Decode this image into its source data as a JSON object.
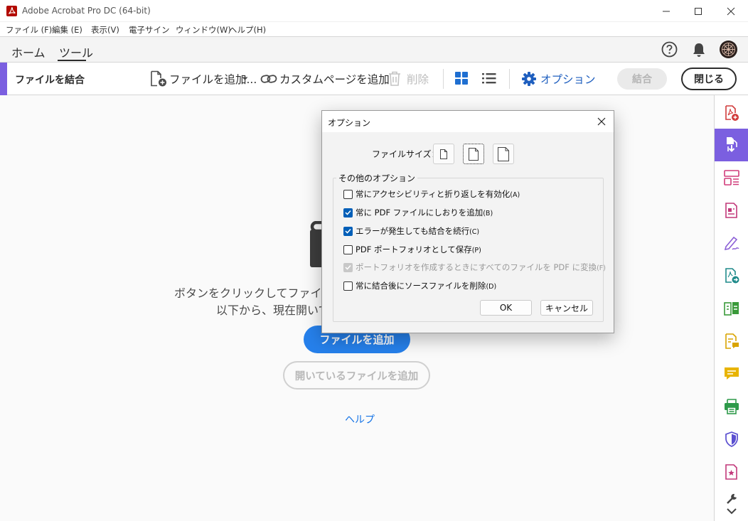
{
  "window": {
    "title": "Adobe Acrobat Pro DC (64-bit)",
    "controls": [
      "minimize-icon",
      "maximize-icon",
      "close-icon"
    ]
  },
  "menu": [
    {
      "label": "ファイル (F)"
    },
    {
      "label": "編集 (E)"
    },
    {
      "label": "表示(V)"
    },
    {
      "label": "電子サイン"
    },
    {
      "label": "ウィンドウ(W)"
    },
    {
      "label": "ヘルプ(H)"
    }
  ],
  "tabs": {
    "home": "ホーム",
    "tools": "ツール",
    "active": "ツール"
  },
  "header_icons": [
    "help-icon",
    "bell-icon",
    "avatar"
  ],
  "toolbar": {
    "tool_name": "ファイルを結合",
    "add_files": "ファイルを追加...",
    "custom_page": "カスタムページを追加",
    "delete": "削除",
    "options": "オプション",
    "combine": "結合",
    "close": "閉じる"
  },
  "main": {
    "line1": "ボタンをクリックしてファイルを追加",
    "line2": "以下から、現在開いて",
    "add_files_button": "ファイルを追加",
    "add_open_files_button": "開いているファイルを追加",
    "help": "ヘルプ"
  },
  "right_rail": [
    "create-pdf-icon",
    "combine-files-icon",
    "organize-pages-icon",
    "edit-pdf-icon",
    "fill-sign-icon",
    "export-pdf-icon",
    "compare-icon",
    "send-comments-icon",
    "comment-icon",
    "print-production-icon",
    "protect-icon",
    "request-signature-icon",
    "more-tools-icon"
  ],
  "dialog": {
    "title": "オプション",
    "file_size_label": "ファイルサイズ：",
    "file_size_selected": 1,
    "group_title": "その他のオプション",
    "options": [
      {
        "label": "常にアクセシビリティと折り返しを有効化",
        "key": "(A)",
        "checked": false,
        "enabled": true
      },
      {
        "label": "常に PDF ファイルにしおりを追加",
        "key": "(B)",
        "checked": true,
        "enabled": true
      },
      {
        "label": "エラーが発生しても結合を続行",
        "key": "(C)",
        "checked": true,
        "enabled": true
      },
      {
        "label": "PDF ポートフォリオとして保存",
        "key": "(P)",
        "checked": false,
        "enabled": true
      },
      {
        "label": "ポートフォリオを作成するときにすべてのファイルを PDF に変換",
        "key": "(F)",
        "checked": true,
        "enabled": false
      },
      {
        "label": "常に結合後にソースファイルを削除",
        "key": "(D)",
        "checked": false,
        "enabled": true
      }
    ],
    "ok": "OK",
    "cancel": "キャンセル"
  },
  "colors": {
    "accent_purple": "#7b5fe0",
    "primary_blue": "#2680eb",
    "link_blue": "#1473e6",
    "acrobat_red": "#b30b00"
  }
}
